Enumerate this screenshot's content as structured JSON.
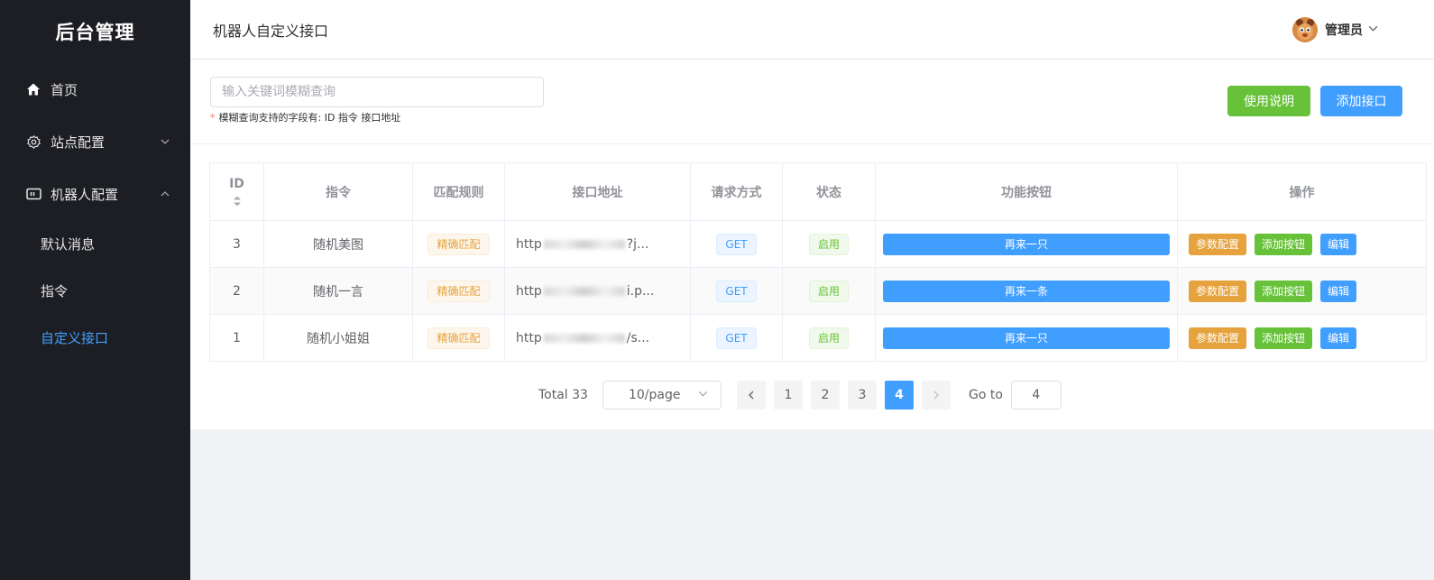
{
  "sidebar": {
    "brand": "后台管理",
    "items": [
      {
        "label": "首页"
      },
      {
        "label": "站点配置"
      },
      {
        "label": "机器人配置"
      }
    ],
    "subitems": [
      {
        "label": "默认消息"
      },
      {
        "label": "指令"
      },
      {
        "label": "自定义接口"
      }
    ]
  },
  "header": {
    "title": "机器人自定义接口",
    "user": "管理员"
  },
  "search": {
    "placeholder": "输入关键词模糊查询",
    "hint_star": "*",
    "hint": "模糊查询支持的字段有: ID 指令 接口地址",
    "help_button": "使用说明",
    "add_button": "添加接口"
  },
  "table": {
    "headers": {
      "id": "ID",
      "command": "指令",
      "match": "匹配规则",
      "url": "接口地址",
      "method": "请求方式",
      "status": "状态",
      "func": "功能按钮",
      "ops": "操作"
    },
    "rows": [
      {
        "id": "3",
        "command": "随机美图",
        "match": "精确匹配",
        "url_prefix": "http",
        "url_suffix": "?j...",
        "method": "GET",
        "status": "启用",
        "func": "再来一只"
      },
      {
        "id": "2",
        "command": "随机一言",
        "match": "精确匹配",
        "url_prefix": "http",
        "url_suffix": "i.p...",
        "method": "GET",
        "status": "启用",
        "func": "再来一条"
      },
      {
        "id": "1",
        "command": "随机小姐姐",
        "match": "精确匹配",
        "url_prefix": "http",
        "url_suffix": "/s...",
        "method": "GET",
        "status": "启用",
        "func": "再来一只"
      }
    ],
    "ops": {
      "params": "参数配置",
      "add_btn": "添加按钮",
      "edit": "编辑"
    }
  },
  "pagination": {
    "total": "Total 33",
    "page_size": "10/page",
    "pages": [
      "1",
      "2",
      "3",
      "4"
    ],
    "current": "4",
    "goto_label": "Go to",
    "goto_value": "4"
  },
  "colors": {
    "sidebar_bg": "#1d1e23",
    "primary": "#409eff",
    "success": "#67c23a",
    "warning": "#e6a23c"
  }
}
